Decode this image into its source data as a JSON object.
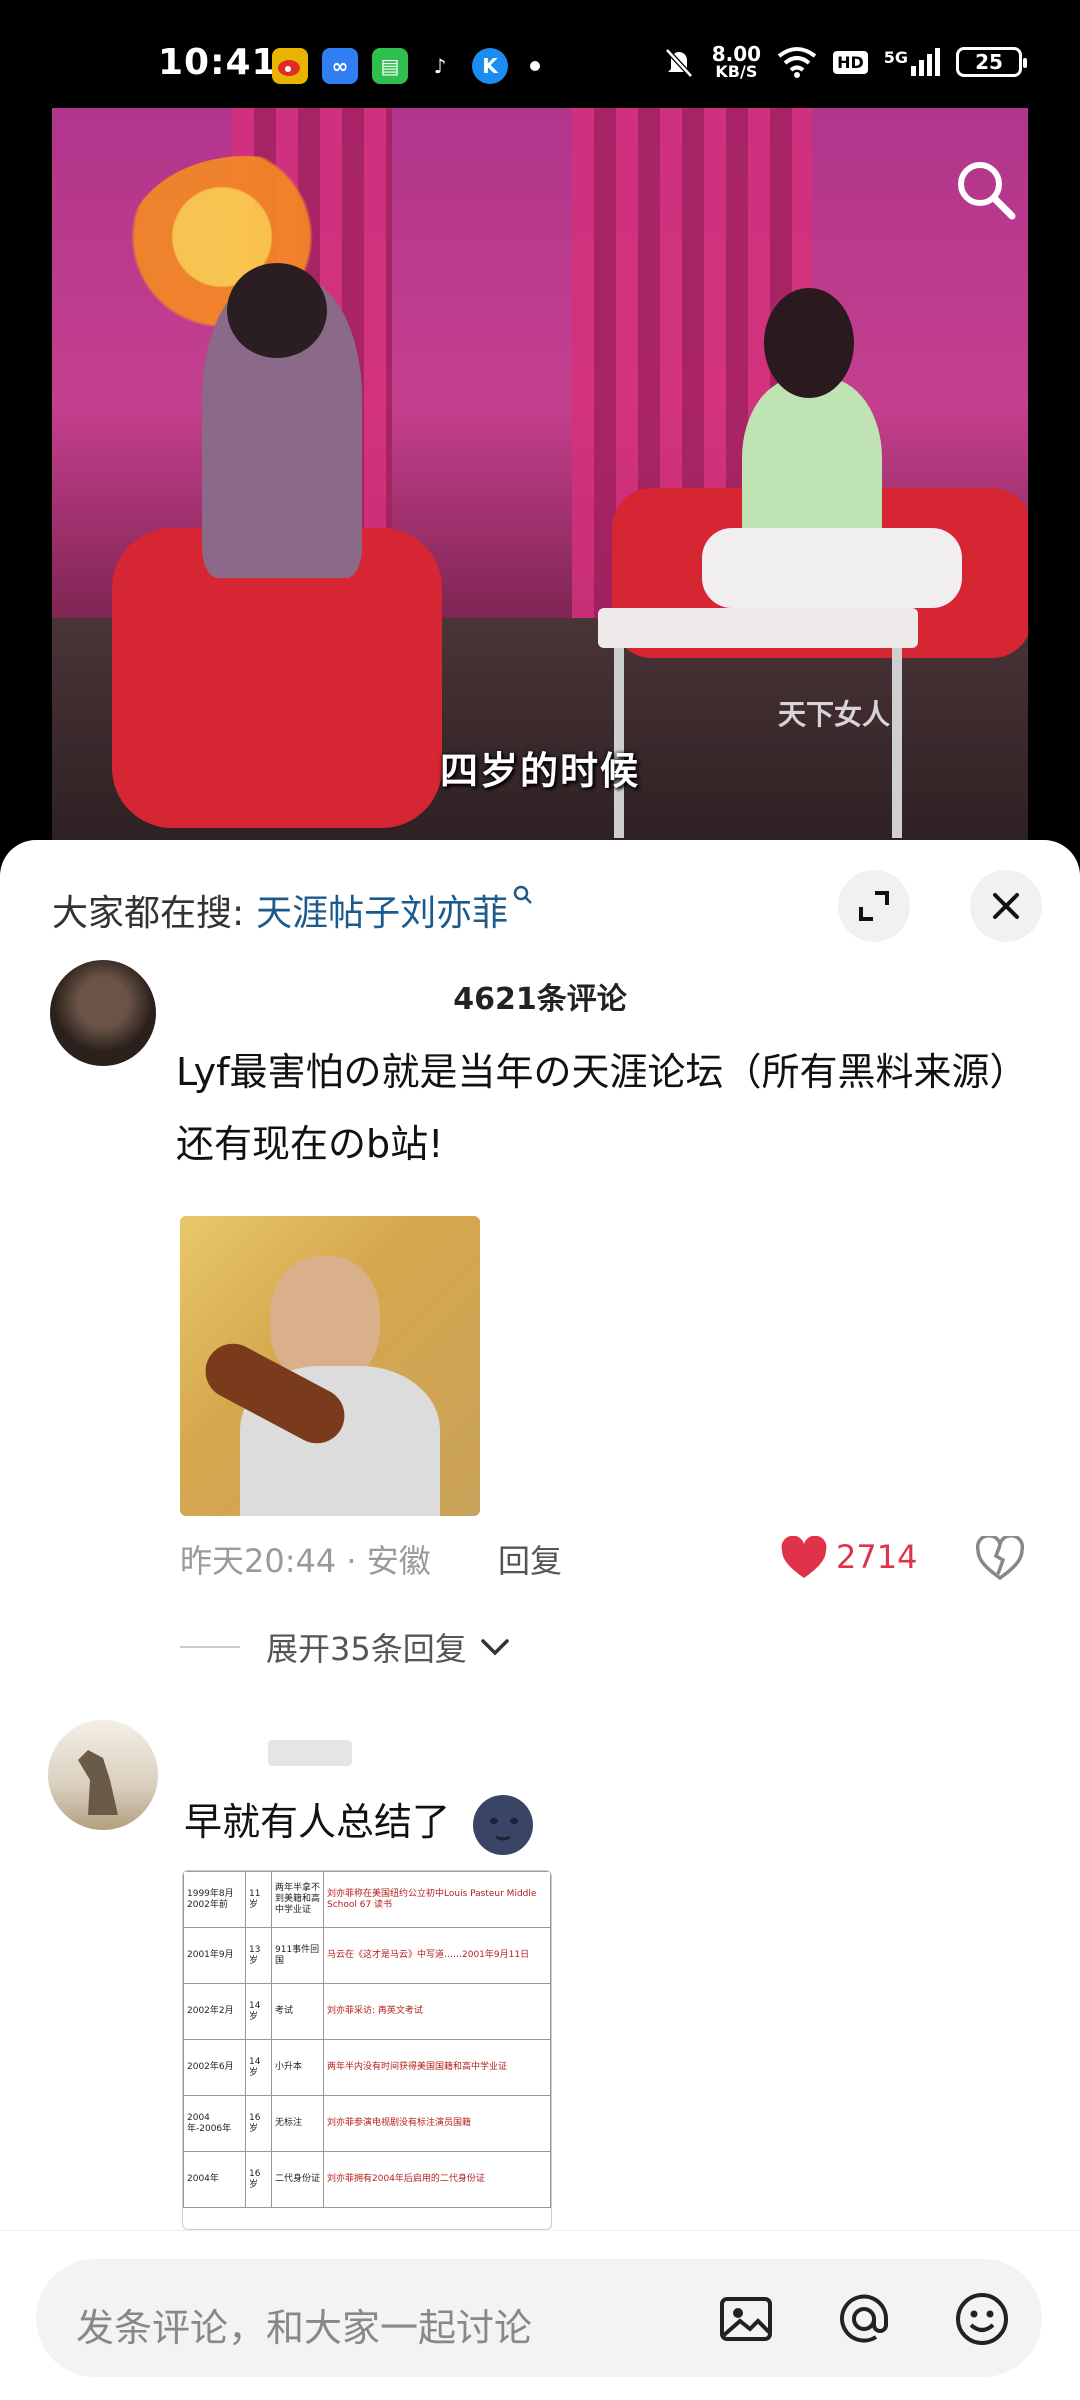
{
  "status_bar": {
    "time": "10:41",
    "net_speed_value": "8.00",
    "net_speed_unit": "KB/S",
    "hd": "HD",
    "network": "5G",
    "battery": "25"
  },
  "video": {
    "subtitle": "四岁的时候",
    "watermark": "天下女人"
  },
  "sheet": {
    "search_lead": "大家都在搜:",
    "search_term": "天涯帖子刘亦菲",
    "comment_count": "4621条评论"
  },
  "comments": [
    {
      "text": "Lyf最害怕の就是当年の天涯论坛（所有黑料来源）还有现在のb站!",
      "time": "昨天20:44",
      "location": "安徽",
      "reply_label": "回复",
      "likes": "2714",
      "expand_label": "展开35条回复"
    },
    {
      "text": "早就有人总结了",
      "table_rows": [
        {
          "date": "1999年8月 2002年前",
          "age": "11岁",
          "tag": "两年半拿不到美籍和高中学业证",
          "note": "刘亦菲称在美国纽约公立初中Louis Pasteur Middle School 67 读书"
        },
        {
          "date": "2001年9月",
          "age": "13岁",
          "tag": "911事件回国",
          "note": "马云在《这才是马云》中写道……2001年9月11日"
        },
        {
          "date": "2002年2月",
          "age": "14岁",
          "tag": "考试",
          "note": "刘亦菲采访: 再英文考试"
        },
        {
          "date": "2002年6月",
          "age": "14岁",
          "tag": "小升本",
          "note": "两年半内没有时间获得美国国籍和高中学业证"
        },
        {
          "date": "2004年-2006年",
          "age": "16岁",
          "tag": "无标注",
          "note": "刘亦菲参演电视剧没有标注演员国籍"
        },
        {
          "date": "2004年",
          "age": "16岁",
          "tag": "二代身份证",
          "note": "刘亦菲拥有2004年后启用的二代身份证"
        }
      ]
    }
  ],
  "bottom_bar": {
    "placeholder": "发条评论，和大家一起讨论"
  },
  "colors": {
    "link": "#1c5a8c",
    "like": "#e0334a",
    "meta": "#9a9a9a"
  }
}
